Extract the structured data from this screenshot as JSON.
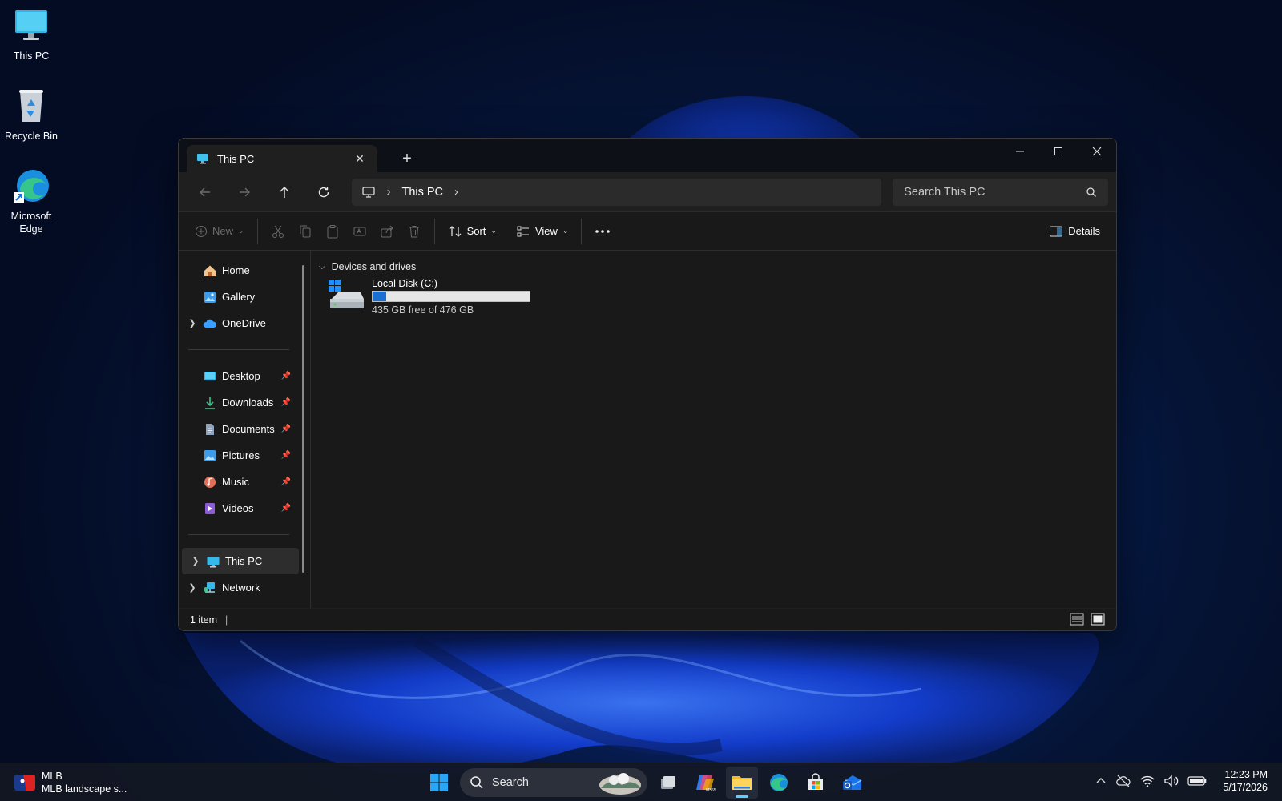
{
  "desktop": {
    "icons": [
      {
        "label": "This PC"
      },
      {
        "label": "Recycle Bin"
      },
      {
        "label": "Microsoft Edge"
      }
    ]
  },
  "window": {
    "tab_title": "This PC",
    "address": {
      "crumbs": [
        "This PC"
      ]
    },
    "search": {
      "placeholder": "Search This PC"
    },
    "toolbar": {
      "new_label": "New",
      "sort_label": "Sort",
      "view_label": "View",
      "details_label": "Details"
    },
    "sidebar": {
      "top": [
        {
          "label": "Home"
        },
        {
          "label": "Gallery"
        },
        {
          "label": "OneDrive"
        }
      ],
      "pinned": [
        {
          "label": "Desktop"
        },
        {
          "label": "Downloads"
        },
        {
          "label": "Documents"
        },
        {
          "label": "Pictures"
        },
        {
          "label": "Music"
        },
        {
          "label": "Videos"
        }
      ],
      "bottom": [
        {
          "label": "This PC"
        },
        {
          "label": "Network"
        }
      ]
    },
    "content": {
      "group_title": "Devices and drives",
      "drives": [
        {
          "name": "Local Disk (C:)",
          "free_text": "435 GB free of 476 GB",
          "used_fraction": 0.086
        }
      ]
    },
    "status": {
      "item_count": "1 item"
    }
  },
  "taskbar": {
    "widget": {
      "title": "MLB",
      "subtitle": "MLB landscape s..."
    },
    "search_label": "Search",
    "clock": {
      "time": "12:23 PM",
      "date": "5/17/2026"
    }
  },
  "colors": {
    "accent": "#60cdff",
    "drive_fill": "#1a6fd1"
  }
}
